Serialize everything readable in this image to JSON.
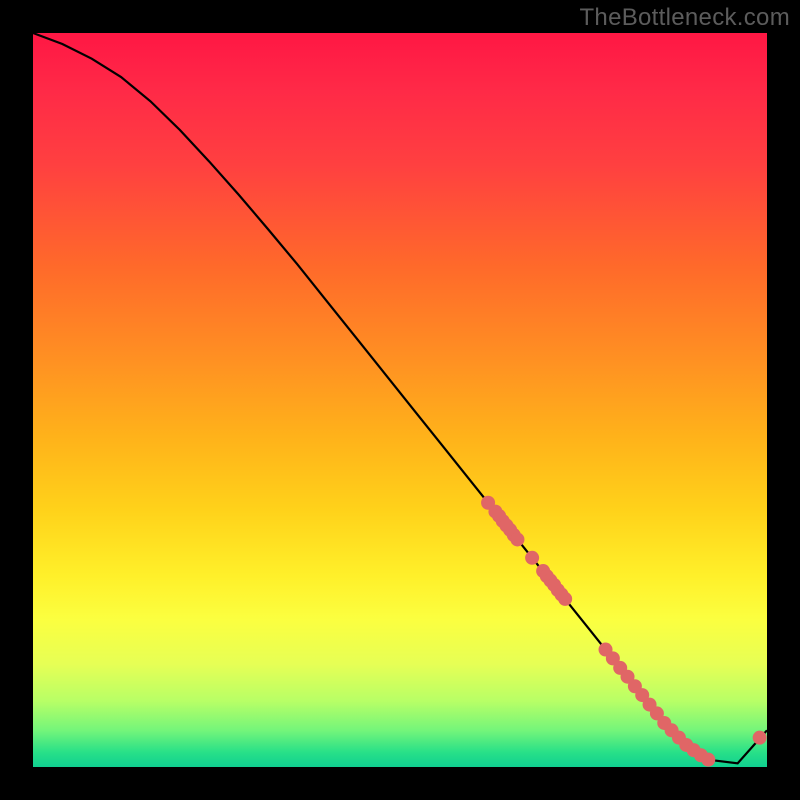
{
  "watermark": "TheBottleneck.com",
  "chart_data": {
    "type": "line",
    "title": "",
    "xlabel": "",
    "ylabel": "",
    "xlim": [
      0,
      100
    ],
    "ylim": [
      0,
      100
    ],
    "curve": {
      "x": [
        0,
        4,
        8,
        12,
        16,
        20,
        24,
        28,
        32,
        36,
        40,
        44,
        48,
        52,
        56,
        60,
        64,
        68,
        72,
        76,
        80,
        84,
        88,
        92,
        96,
        100
      ],
      "y": [
        100,
        98.5,
        96.5,
        94.0,
        90.7,
        86.8,
        82.5,
        78.0,
        73.3,
        68.5,
        63.5,
        58.5,
        53.5,
        48.5,
        43.5,
        38.5,
        33.5,
        28.5,
        23.5,
        18.5,
        13.5,
        8.5,
        4.0,
        1.0,
        0.5,
        5.0
      ]
    },
    "markers": {
      "x": [
        62,
        63,
        63.5,
        64,
        64.5,
        65,
        65.5,
        66,
        68,
        69.5,
        70,
        70.5,
        71,
        71.5,
        72,
        72.5,
        78,
        79,
        80,
        81,
        82,
        83,
        84,
        85,
        86,
        87,
        88,
        89,
        90,
        91,
        92,
        99.0
      ],
      "y": [
        36.0,
        34.8,
        34.2,
        33.5,
        32.9,
        32.3,
        31.6,
        31.0,
        28.5,
        26.7,
        26.0,
        25.4,
        24.8,
        24.1,
        23.5,
        22.9,
        16.0,
        14.8,
        13.5,
        12.3,
        11.0,
        9.8,
        8.5,
        7.3,
        6.0,
        5.0,
        4.0,
        3.0,
        2.3,
        1.6,
        1.0,
        4.0
      ],
      "color": "#e06666",
      "radius": 7
    },
    "gradient_stops": [
      {
        "pos": 0.0,
        "color": "#ff1744"
      },
      {
        "pos": 0.5,
        "color": "#ffb21a"
      },
      {
        "pos": 0.8,
        "color": "#fbff40"
      },
      {
        "pos": 1.0,
        "color": "#10d090"
      }
    ]
  }
}
